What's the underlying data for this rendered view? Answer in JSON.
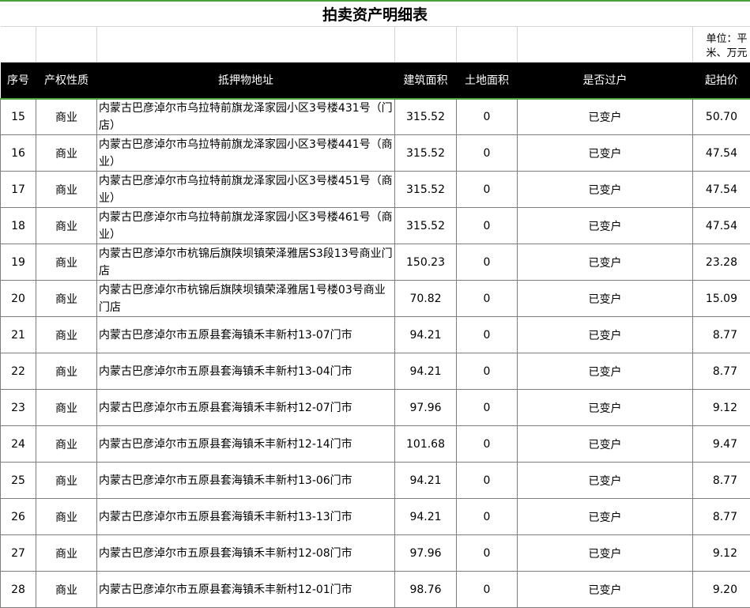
{
  "title": "拍卖资产明细表",
  "unit_note_line1": "单位：平",
  "unit_note_line2": "米、万元",
  "headers": {
    "no": "序号",
    "type": "产权性质",
    "address": "抵押物地址",
    "build_area": "建筑面积",
    "land_area": "土地面积",
    "transfer": "是否过户",
    "price": "起拍价"
  },
  "rows": [
    {
      "no": "15",
      "type": "商业",
      "address": "内蒙古巴彦淖尔市乌拉特前旗龙泽家园小区3号楼431号（门店）",
      "build_area": "315.52",
      "land_area": "0",
      "transfer": "已变户",
      "price": "50.70"
    },
    {
      "no": "16",
      "type": "商业",
      "address": "内蒙古巴彦淖尔市乌拉特前旗龙泽家园小区3号楼441号（商业）",
      "build_area": "315.52",
      "land_area": "0",
      "transfer": "已变户",
      "price": "47.54"
    },
    {
      "no": "17",
      "type": "商业",
      "address": "内蒙古巴彦淖尔市乌拉特前旗龙泽家园小区3号楼451号（商业）",
      "build_area": "315.52",
      "land_area": "0",
      "transfer": "已变户",
      "price": "47.54"
    },
    {
      "no": "18",
      "type": "商业",
      "address": "内蒙古巴彦淖尔市乌拉特前旗龙泽家园小区3号楼461号（商业）",
      "build_area": "315.52",
      "land_area": "0",
      "transfer": "已变户",
      "price": "47.54"
    },
    {
      "no": "19",
      "type": "商业",
      "address": "内蒙古巴彦淖尔市杭锦后旗陕坝镇荣泽雅居S3段13号商业门店",
      "build_area": "150.23",
      "land_area": "0",
      "transfer": "已变户",
      "price": "23.28"
    },
    {
      "no": "20",
      "type": "商业",
      "address": "内蒙古巴彦淖尔市杭锦后旗陕坝镇荣泽雅居1号楼03号商业门店",
      "build_area": "70.82",
      "land_area": "0",
      "transfer": "已变户",
      "price": "15.09"
    },
    {
      "no": "21",
      "type": "商业",
      "address": "内蒙古巴彦淖尔市五原县套海镇禾丰新村13-07门市",
      "build_area": "94.21",
      "land_area": "0",
      "transfer": "已变户",
      "price": "8.77"
    },
    {
      "no": "22",
      "type": "商业",
      "address": "内蒙古巴彦淖尔市五原县套海镇禾丰新村13-04门市",
      "build_area": "94.21",
      "land_area": "0",
      "transfer": "已变户",
      "price": "8.77"
    },
    {
      "no": "23",
      "type": "商业",
      "address": "内蒙古巴彦淖尔市五原县套海镇禾丰新村12-07门市",
      "build_area": "97.96",
      "land_area": "0",
      "transfer": "已变户",
      "price": "9.12"
    },
    {
      "no": "24",
      "type": "商业",
      "address": "内蒙古巴彦淖尔市五原县套海镇禾丰新村12-14门市",
      "build_area": "101.68",
      "land_area": "0",
      "transfer": "已变户",
      "price": "9.47"
    },
    {
      "no": "25",
      "type": "商业",
      "address": "内蒙古巴彦淖尔市五原县套海镇禾丰新村13-06门市",
      "build_area": "94.21",
      "land_area": "0",
      "transfer": "已变户",
      "price": "8.77"
    },
    {
      "no": "26",
      "type": "商业",
      "address": "内蒙古巴彦淖尔市五原县套海镇禾丰新村13-13门市",
      "build_area": "94.21",
      "land_area": "0",
      "transfer": "已变户",
      "price": "8.77"
    },
    {
      "no": "27",
      "type": "商业",
      "address": "内蒙古巴彦淖尔市五原县套海镇禾丰新村12-08门市",
      "build_area": "97.96",
      "land_area": "0",
      "transfer": "已变户",
      "price": "9.12"
    },
    {
      "no": "28",
      "type": "商业",
      "address": "内蒙古巴彦淖尔市五原县套海镇禾丰新村12-01门市",
      "build_area": "98.76",
      "land_area": "0",
      "transfer": "已变户",
      "price": "9.20"
    }
  ]
}
